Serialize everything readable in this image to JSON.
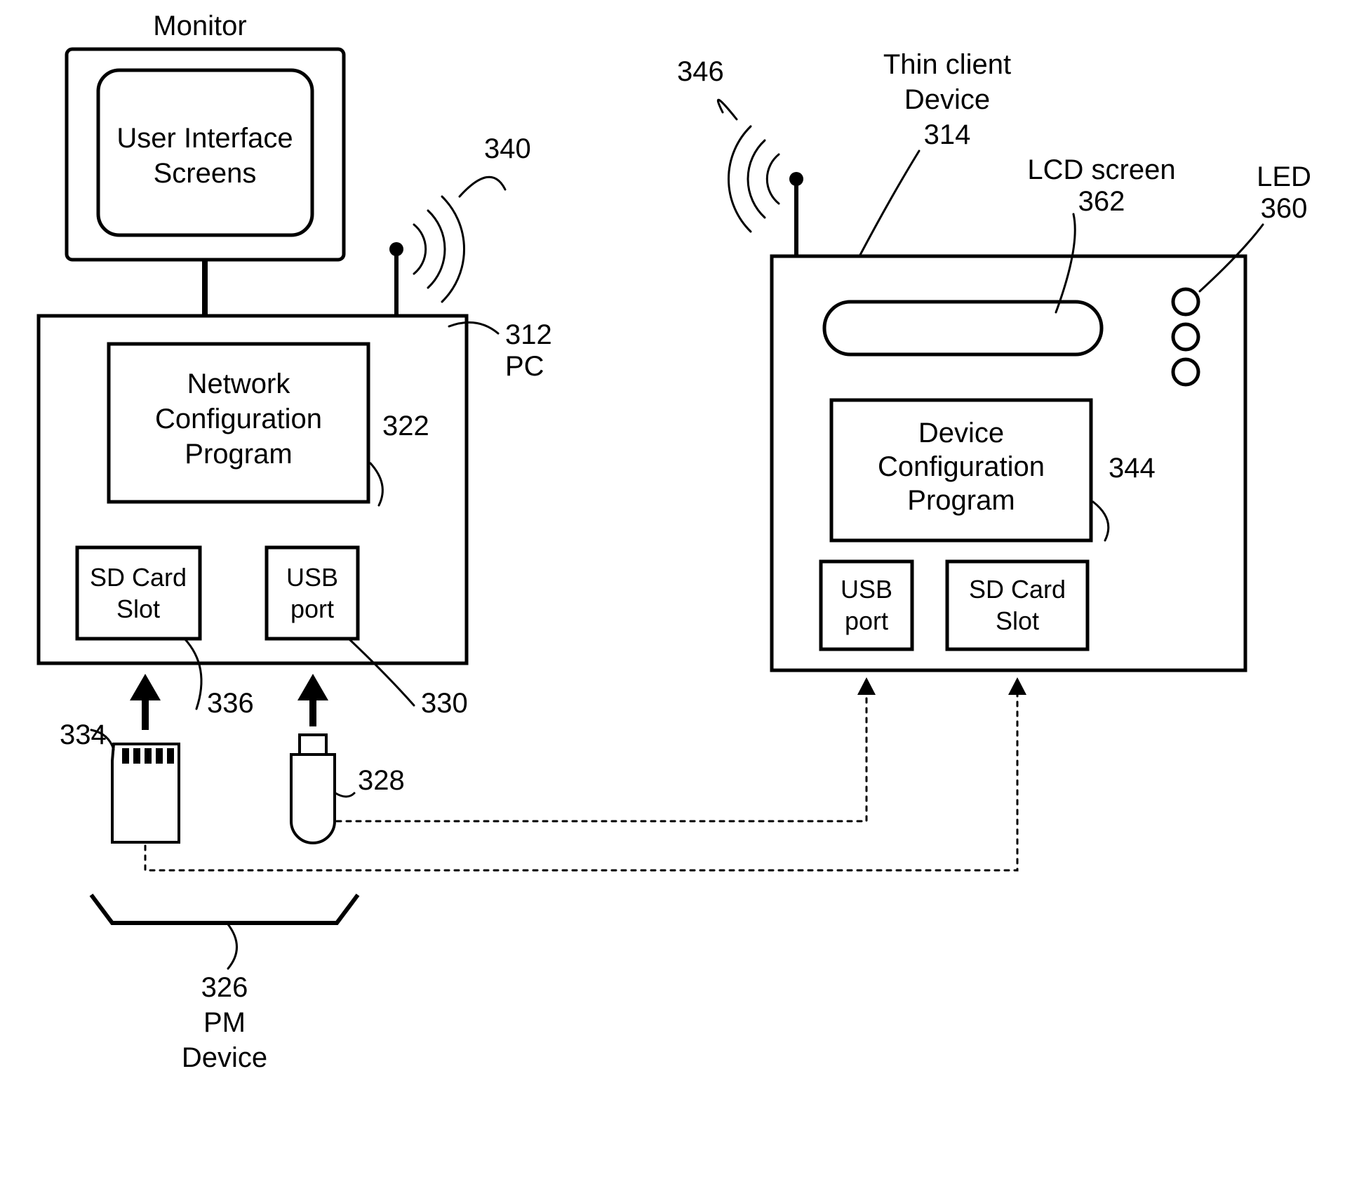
{
  "labels": {
    "monitor": "Monitor",
    "ui_screens_l1": "User Interface",
    "ui_screens_l2": "Screens",
    "net_prog_l1": "Network",
    "net_prog_l2": "Configuration",
    "net_prog_l3": "Program",
    "sd_slot_l1": "SD Card",
    "sd_slot_l2": "Slot",
    "usb_port_l1": "USB",
    "usb_port_l2": "port",
    "pc": "PC",
    "pm_l1": "PM",
    "pm_l2": "Device",
    "thin_client_l1": "Thin client",
    "thin_client_l2": "Device",
    "dev_prog_l1": "Device",
    "dev_prog_l2": "Configuration",
    "dev_prog_l3": "Program",
    "usb_port2_l1": "USB",
    "usb_port2_l2": "port",
    "sd_slot2_l1": "SD Card",
    "sd_slot2_l2": "Slot",
    "lcd_l1": "LCD screen",
    "led": "LED"
  },
  "refs": {
    "pc": "312",
    "thin_client": "314",
    "net_prog": "322",
    "pm": "326",
    "usb_drive": "328",
    "usb_port": "330",
    "sd_card": "334",
    "sd_slot": "336",
    "pc_antenna": "340",
    "dev_prog": "344",
    "dev_antenna": "346",
    "led": "360",
    "lcd": "362"
  }
}
